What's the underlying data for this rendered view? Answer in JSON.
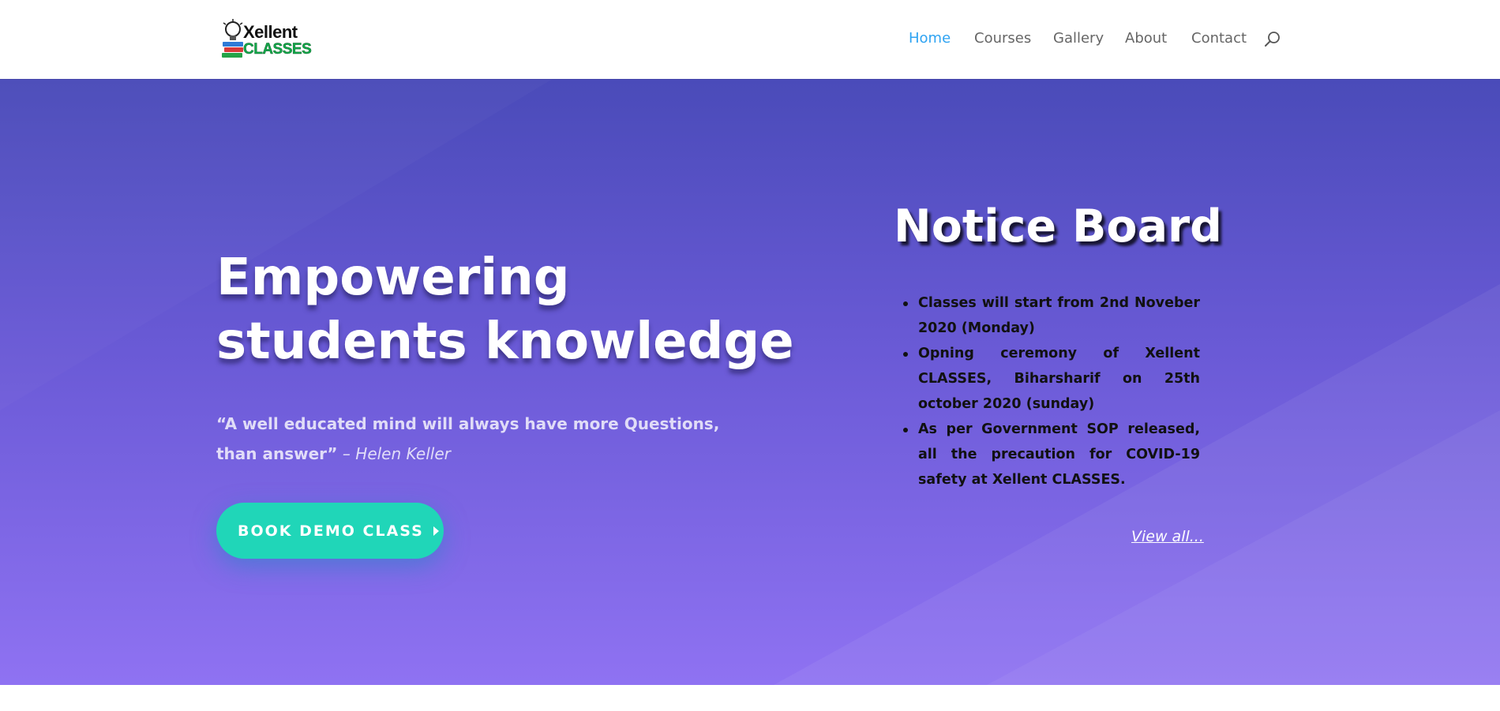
{
  "header": {
    "logo": {
      "line1": "Xellent",
      "line2": "CLASSES",
      "icon": "lightbulb-books-icon"
    },
    "nav": [
      {
        "label": "Home",
        "active": true
      },
      {
        "label": "Courses",
        "active": false
      },
      {
        "label": "Gallery",
        "active": false
      },
      {
        "label": "About",
        "active": false
      },
      {
        "label": "Contact",
        "active": false
      }
    ],
    "search_icon": "search-icon",
    "accent_color": "#2ea3f2"
  },
  "hero": {
    "headline_line1": "Empowering",
    "headline_line2": "students knowledge",
    "quote_text": "“A well educated mind will always have more Questions, than answer”",
    "quote_author": " – Helen Keller",
    "button_label": "BOOK DEMO CLASS",
    "button_color": "#20d6b8"
  },
  "notice_board": {
    "title": "Notice Board",
    "items": [
      "Classes will start from 2nd Noveber 2020 (Monday)",
      "Opning ceremony of Xellent CLASSES, Biharsharif on 25th october 2020 (sunday)",
      "As per Government SOP released, all the precaution for COVID-19 safety at Xellent CLASSES."
    ],
    "view_all_label": "View all..."
  }
}
